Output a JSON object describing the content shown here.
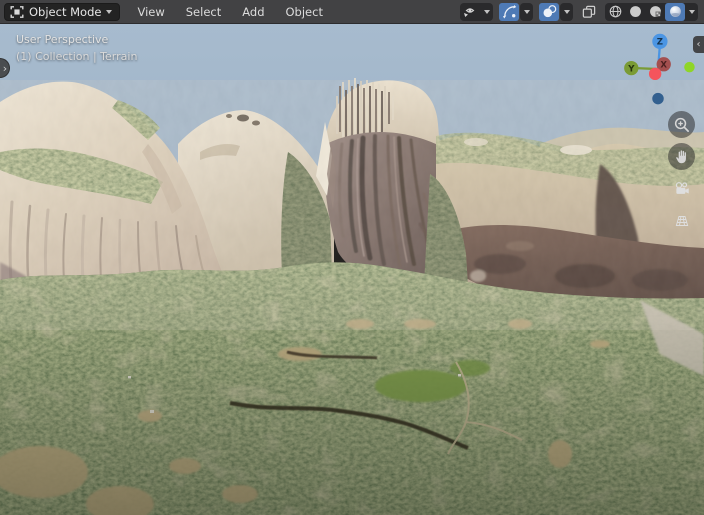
{
  "header": {
    "mode_selector": {
      "label": "Object Mode",
      "icon": "object-mode-icon"
    },
    "menus": [
      {
        "label": "View"
      },
      {
        "label": "Select"
      },
      {
        "label": "Add"
      },
      {
        "label": "Object"
      }
    ],
    "right_controls": {
      "visibility": {
        "icon": "visibility-icon",
        "has_dropdown": true
      },
      "show_gizmo": {
        "icon": "gizmo-icon",
        "active": true,
        "has_dropdown": true
      },
      "show_overlays": {
        "icon": "overlays-icon",
        "active": true,
        "has_dropdown": true
      },
      "toggle_xray": {
        "icon": "xray-icon",
        "active": false
      },
      "shading_modes": [
        {
          "name": "wireframe",
          "icon": "wireframe-icon",
          "active": false
        },
        {
          "name": "solid",
          "icon": "solid-icon",
          "active": false
        },
        {
          "name": "material-preview",
          "icon": "material-preview-icon",
          "active": false
        },
        {
          "name": "rendered",
          "icon": "rendered-icon",
          "active": true
        }
      ]
    }
  },
  "viewport": {
    "overlay": {
      "line1": "User Perspective",
      "line2": "(1) Collection | Terrain"
    },
    "gizmo": {
      "z_label": "Z",
      "y_label": "Y",
      "x_label": "X"
    },
    "tools": [
      {
        "icon": "zoom-icon"
      },
      {
        "icon": "pan-hand-icon"
      },
      {
        "icon": "camera-view-icon"
      },
      {
        "icon": "orthographic-grid-icon"
      }
    ],
    "toggles": {
      "toolbar_arrow": "›",
      "sidebar_arrow": "‹"
    }
  },
  "colors": {
    "header_bg": "#424244",
    "button_bg": "#232323",
    "accent_blue": "#4e7ab5",
    "sky": "#a3b7ca",
    "text": "#e4e4e4",
    "axis_z": "#4b95e3",
    "axis_y": "#7a9b35",
    "axis_x_neg": "#a34f4f",
    "axis_x": "#f4545c",
    "axis_y_neg": "#8fd527",
    "axis_z_neg": "#33608f"
  }
}
